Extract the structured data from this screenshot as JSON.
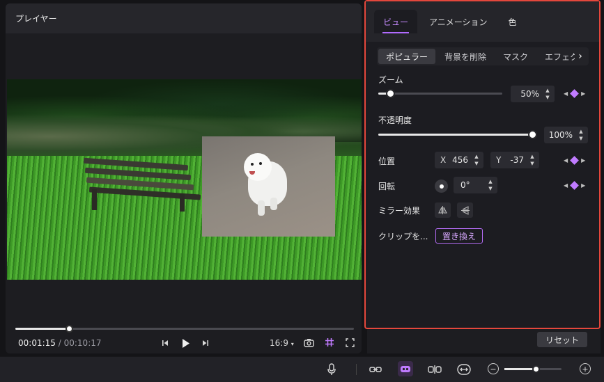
{
  "player": {
    "title": "プレイヤー",
    "current_time": "00:01:15",
    "separator": "/",
    "total_time": "00:10:17",
    "playback_progress": 0.16,
    "aspect_ratio": "16:9",
    "icons": [
      "prev-frame-icon",
      "play-icon",
      "next-frame-icon",
      "chevron-down-icon",
      "camera-icon",
      "grid-icon",
      "fullscreen-icon"
    ]
  },
  "panel": {
    "tabs": [
      {
        "label": "ビュー",
        "active": true
      },
      {
        "label": "アニメーション",
        "active": false
      },
      {
        "label": "色",
        "active": false
      }
    ],
    "subtabs": [
      {
        "label": "ポピュラー",
        "active": true
      },
      {
        "label": "背景を削除",
        "active": false
      },
      {
        "label": "マスク",
        "active": false
      },
      {
        "label": "エフェク",
        "active": false
      }
    ],
    "zoom": {
      "label": "ズーム",
      "value": "50%",
      "slider": 0.1
    },
    "opacity": {
      "label": "不透明度",
      "value": "100%",
      "slider": 1.0
    },
    "position": {
      "label": "位置",
      "x_prefix": "X",
      "x_value": "456",
      "y_prefix": "Y",
      "y_value": "-37"
    },
    "rotation": {
      "label": "回転",
      "value": "0°"
    },
    "mirror": {
      "label": "ミラー効果"
    },
    "clip": {
      "label": "クリップを...",
      "replace_button": "置き換え"
    },
    "accent_color": "#b46cf5",
    "highlight_border": "#e4473c"
  },
  "reset_button": "リセット",
  "toolbar": {
    "icons": [
      "microphone-icon",
      "link-icon",
      "ai-icon",
      "split-icon",
      "fit-icon",
      "zoom-out-icon",
      "zoom-in-icon"
    ],
    "zoom_level": 0.55
  }
}
